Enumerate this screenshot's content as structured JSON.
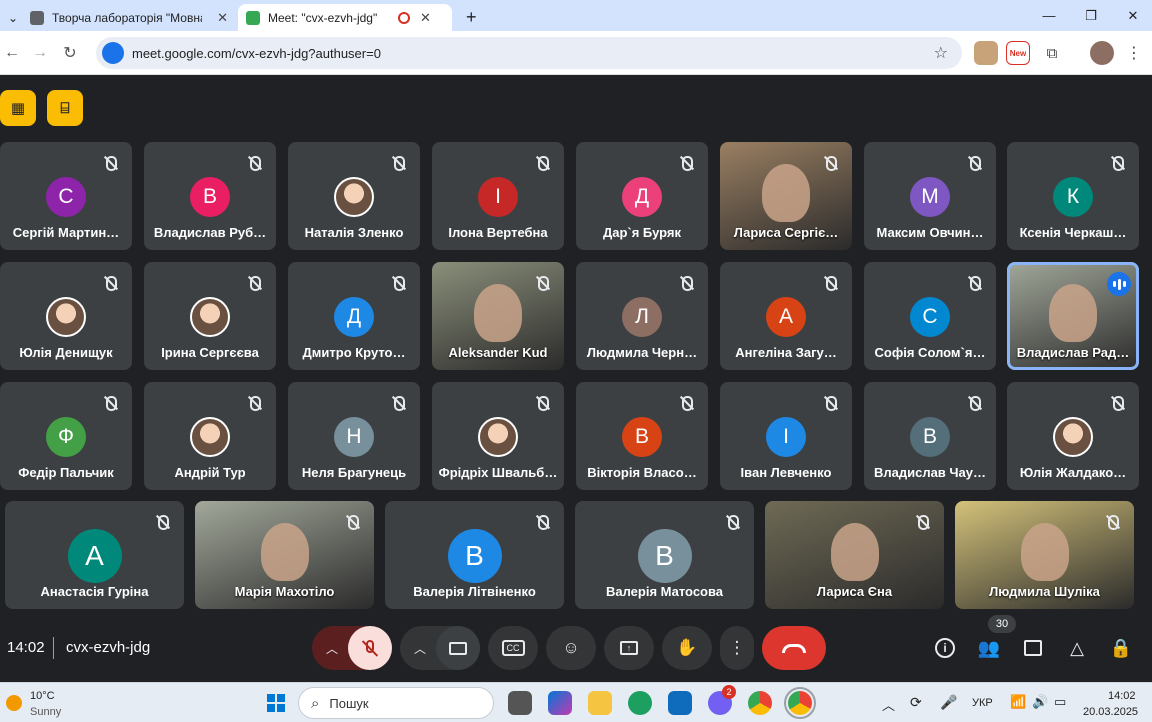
{
  "browser": {
    "tabs": [
      {
        "title": "Творча лабораторія \"Мовна п",
        "active": false
      },
      {
        "title": "Meet: \"cvx-ezvh-jdg\"",
        "active": true
      }
    ],
    "url": "meet.google.com/cvx-ezvh-jdg?authuser=0",
    "new_badge": "New"
  },
  "participants_rows": [
    [
      {
        "name": "Сергій Мартин…",
        "initial": "С",
        "color": "#8e24aa",
        "type": "avatar"
      },
      {
        "name": "Владислав Руб…",
        "initial": "В",
        "color": "#e91e63",
        "type": "avatar"
      },
      {
        "name": "Наталія Зленко",
        "initial": "",
        "color": "",
        "type": "photo"
      },
      {
        "name": "Ілона Вертебна",
        "initial": "І",
        "color": "#c62828",
        "type": "avatar"
      },
      {
        "name": "Дар`я Буряк",
        "initial": "Д",
        "color": "#ec407a",
        "type": "avatar"
      },
      {
        "name": "Лариса Сергіє…",
        "initial": "",
        "color": "",
        "type": "video"
      },
      {
        "name": "Максим Овчин…",
        "initial": "М",
        "color": "#7e57c2",
        "type": "avatar"
      },
      {
        "name": "Ксенія Черкаш…",
        "initial": "К",
        "color": "#00897b",
        "type": "avatar"
      }
    ],
    [
      {
        "name": "Юлія Денищук",
        "initial": "",
        "color": "",
        "type": "photo"
      },
      {
        "name": "Ірина Сергєєва",
        "initial": "",
        "color": "",
        "type": "photo"
      },
      {
        "name": "Дмитро Круто…",
        "initial": "Д",
        "color": "#1e88e5",
        "type": "avatar"
      },
      {
        "name": "Aleksander Kud",
        "initial": "",
        "color": "",
        "type": "video"
      },
      {
        "name": "Людмила Черн…",
        "initial": "Л",
        "color": "#8d6e63",
        "type": "avatar"
      },
      {
        "name": "Ангеліна Загу…",
        "initial": "А",
        "color": "#d84315",
        "type": "avatar"
      },
      {
        "name": "Софія Солом`я…",
        "initial": "С",
        "color": "#0288d1",
        "type": "avatar"
      },
      {
        "name": "Владислав Рад…",
        "initial": "",
        "color": "",
        "type": "video",
        "speaking": true
      }
    ],
    [
      {
        "name": "Федір Пальчик",
        "initial": "Ф",
        "color": "#43a047",
        "type": "avatar"
      },
      {
        "name": "Андрій Тур",
        "initial": "",
        "color": "",
        "type": "photo"
      },
      {
        "name": "Неля Брагунець",
        "initial": "Н",
        "color": "#78909c",
        "type": "avatar"
      },
      {
        "name": "Фрідріх Швальб…",
        "initial": "",
        "color": "",
        "type": "photo"
      },
      {
        "name": "Вікторія Власо…",
        "initial": "В",
        "color": "#d84315",
        "type": "avatar"
      },
      {
        "name": "Іван Левченко",
        "initial": "І",
        "color": "#1e88e5",
        "type": "avatar"
      },
      {
        "name": "Владислав Чау…",
        "initial": "В",
        "color": "#546e7a",
        "type": "avatar"
      },
      {
        "name": "Юлія Жалдако…",
        "initial": "",
        "color": "",
        "type": "photo"
      }
    ],
    [
      {
        "name": "Анастасія Гуріна",
        "initial": "А",
        "color": "#00897b",
        "type": "avatar"
      },
      {
        "name": "Марія Махотіло",
        "initial": "",
        "color": "",
        "type": "video"
      },
      {
        "name": "Валерія Літвіненко",
        "initial": "В",
        "color": "#1e88e5",
        "type": "avatar"
      },
      {
        "name": "Валерія Матосова",
        "initial": "В",
        "color": "#78909c",
        "type": "avatar"
      },
      {
        "name": "Лариса Єна",
        "initial": "",
        "color": "",
        "type": "video"
      },
      {
        "name": "Людмила Шуліка",
        "initial": "",
        "color": "",
        "type": "video"
      }
    ]
  ],
  "meeting": {
    "time": "14:02",
    "code": "cvx-ezvh-jdg",
    "participant_count": "30"
  },
  "taskbar": {
    "temp": "10°C",
    "weather": "Sunny",
    "search_placeholder": "Пошук",
    "lang": "УКР",
    "time": "14:02",
    "date": "20.03.2025",
    "badge": "2"
  }
}
